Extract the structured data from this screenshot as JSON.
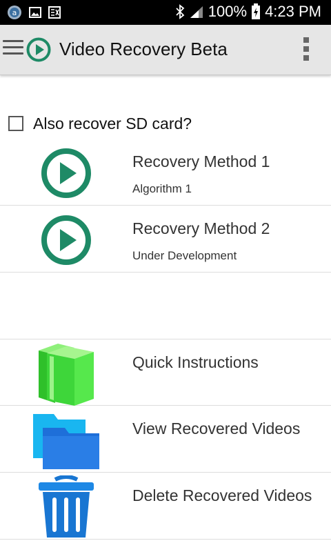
{
  "status_bar": {
    "battery": "100%",
    "time": "4:23 PM"
  },
  "app_bar": {
    "title": "Video Recovery Beta"
  },
  "sd_option": {
    "label": "Also recover SD card?",
    "checked": false
  },
  "methods": [
    {
      "title": "Recovery Method 1",
      "subtitle": "Algorithm 1"
    },
    {
      "title": "Recovery Method 2",
      "subtitle": "Under Development"
    }
  ],
  "actions": [
    {
      "title": "Quick Instructions",
      "icon": "book-icon"
    },
    {
      "title": "View Recovered Videos",
      "icon": "folder-icon"
    },
    {
      "title": "Delete Recovered Videos",
      "icon": "trash-icon"
    }
  ],
  "colors": {
    "accent_green": "#1e8a66",
    "book_green": "#3ed63a",
    "folder_blue": "#1e88e5",
    "trash_blue": "#1976d2"
  }
}
